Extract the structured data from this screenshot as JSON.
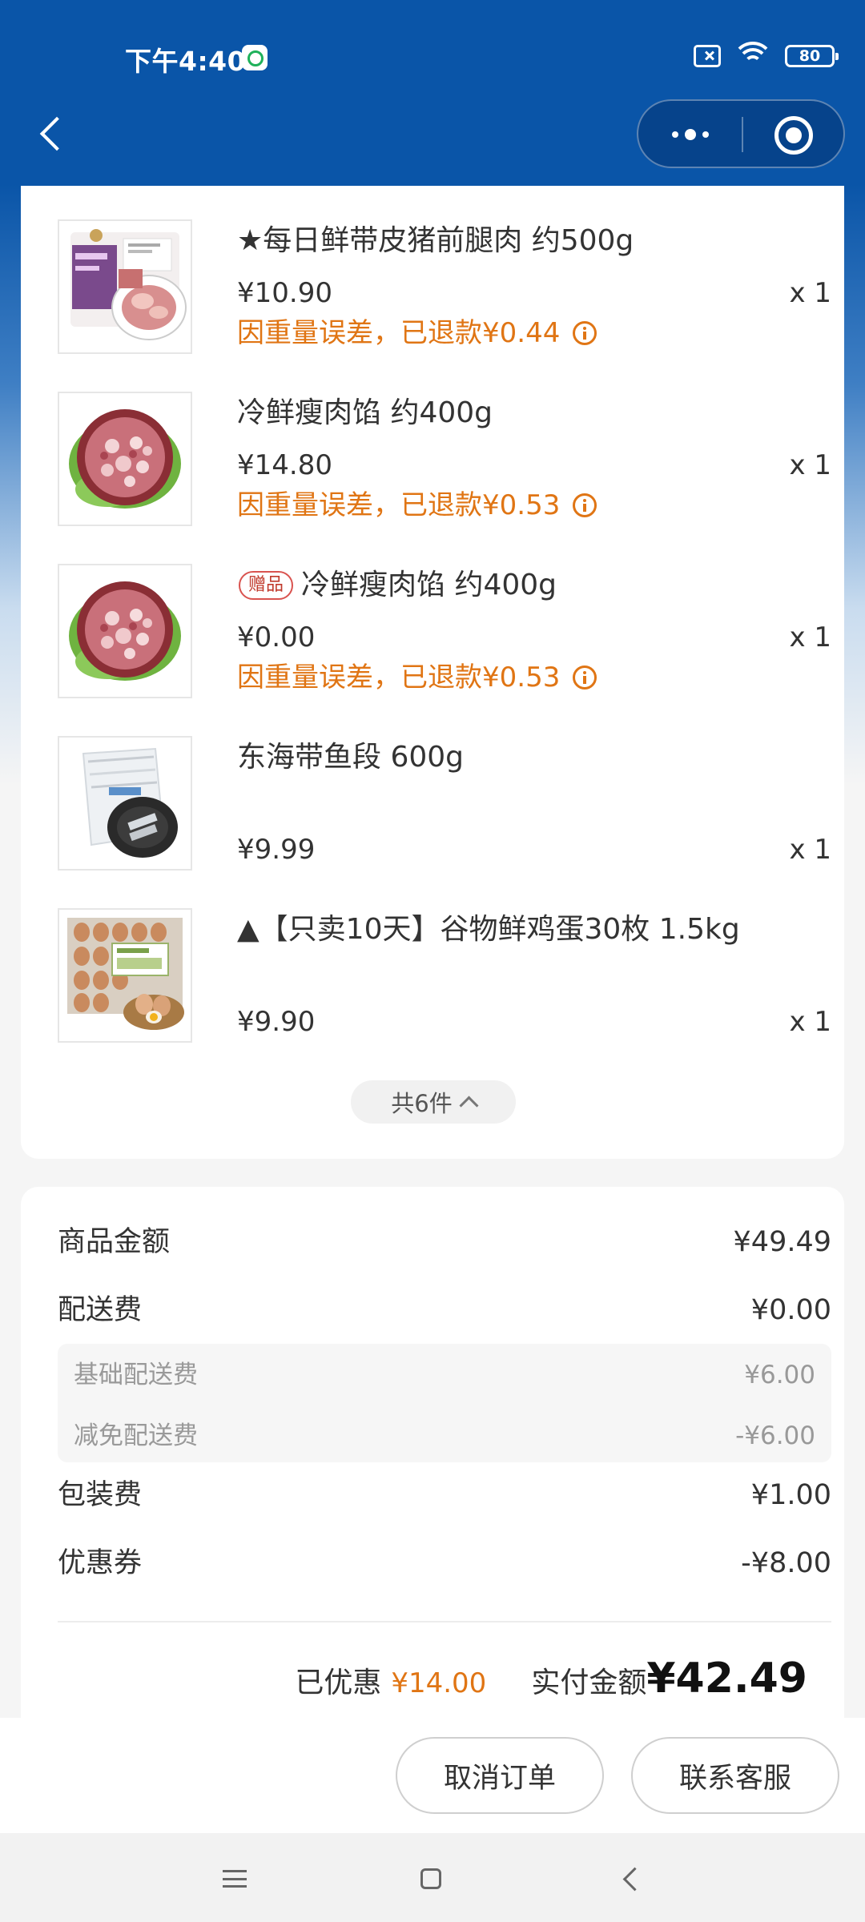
{
  "status_bar": {
    "time": "下午4:40",
    "battery": "80"
  },
  "products": [
    {
      "name": "★每日鲜带皮猪前腿肉 约500g",
      "price": "¥10.90",
      "qty": "x 1",
      "refund": "因重量误差，已退款¥0.44",
      "thumb_icon": "pork-leg-package-image"
    },
    {
      "name": "冷鲜瘦肉馅 约400g",
      "price": "¥14.80",
      "qty": "x 1",
      "refund": "因重量误差，已退款¥0.53",
      "thumb_icon": "minced-pork-image"
    },
    {
      "tag": "赠品",
      "name": "冷鲜瘦肉馅 约400g",
      "price": "¥0.00",
      "qty": "x 1",
      "refund": "因重量误差，已退款¥0.53",
      "thumb_icon": "minced-pork-image"
    },
    {
      "name": "东海带鱼段 600g",
      "price": "¥9.99",
      "qty": "x 1",
      "thumb_icon": "hairtail-fish-bag-image"
    },
    {
      "name": "▲【只卖10天】谷物鲜鸡蛋30枚 1.5kg",
      "price": "¥9.90",
      "qty": "x 1",
      "thumb_icon": "eggs-tray-image"
    }
  ],
  "total_count": "共6件",
  "summary": {
    "goods_amount_label": "商品金额",
    "goods_amount_value": "¥49.49",
    "delivery_label": "配送费",
    "delivery_value": "¥0.00",
    "base_delivery_label": "基础配送费",
    "base_delivery_value": "¥6.00",
    "delivery_discount_label": "减免配送费",
    "delivery_discount_value": "-¥6.00",
    "packaging_label": "包装费",
    "packaging_value": "¥1.00",
    "coupon_label": "优惠券",
    "coupon_value": "-¥8.00",
    "saved_label": "已优惠",
    "saved_value": "¥14.00",
    "paid_label": "实付金额",
    "paid_value": "¥42.49"
  },
  "actions": {
    "cancel_order": "取消订单",
    "contact_service": "联系客服"
  },
  "colors": {
    "header_blue": "#0a55a8",
    "refund_orange": "#e07514",
    "gift_tag_red": "#d9534f"
  }
}
